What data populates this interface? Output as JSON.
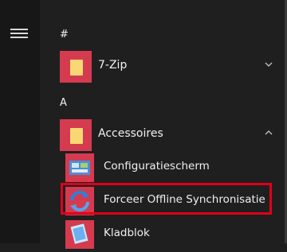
{
  "start_menu": {
    "groups": [
      {
        "letter": "#",
        "apps": [
          {
            "label": "7-Zip",
            "icon": "folder-icon",
            "expanded": false
          }
        ]
      },
      {
        "letter": "A",
        "apps": [
          {
            "label": "Accessoires",
            "icon": "folder-icon",
            "expanded": true,
            "children": [
              {
                "label": "Configuratiescherm",
                "icon": "control-panel-icon"
              },
              {
                "label": "Forceer Offline Synchronisatie",
                "icon": "sync-icon",
                "highlighted": true
              },
              {
                "label": "Kladblok",
                "icon": "notepad-icon"
              }
            ]
          }
        ]
      }
    ]
  },
  "colors": {
    "tile": "#d43b4f",
    "highlight": "#e0001a",
    "background": "#1f1f1f"
  }
}
